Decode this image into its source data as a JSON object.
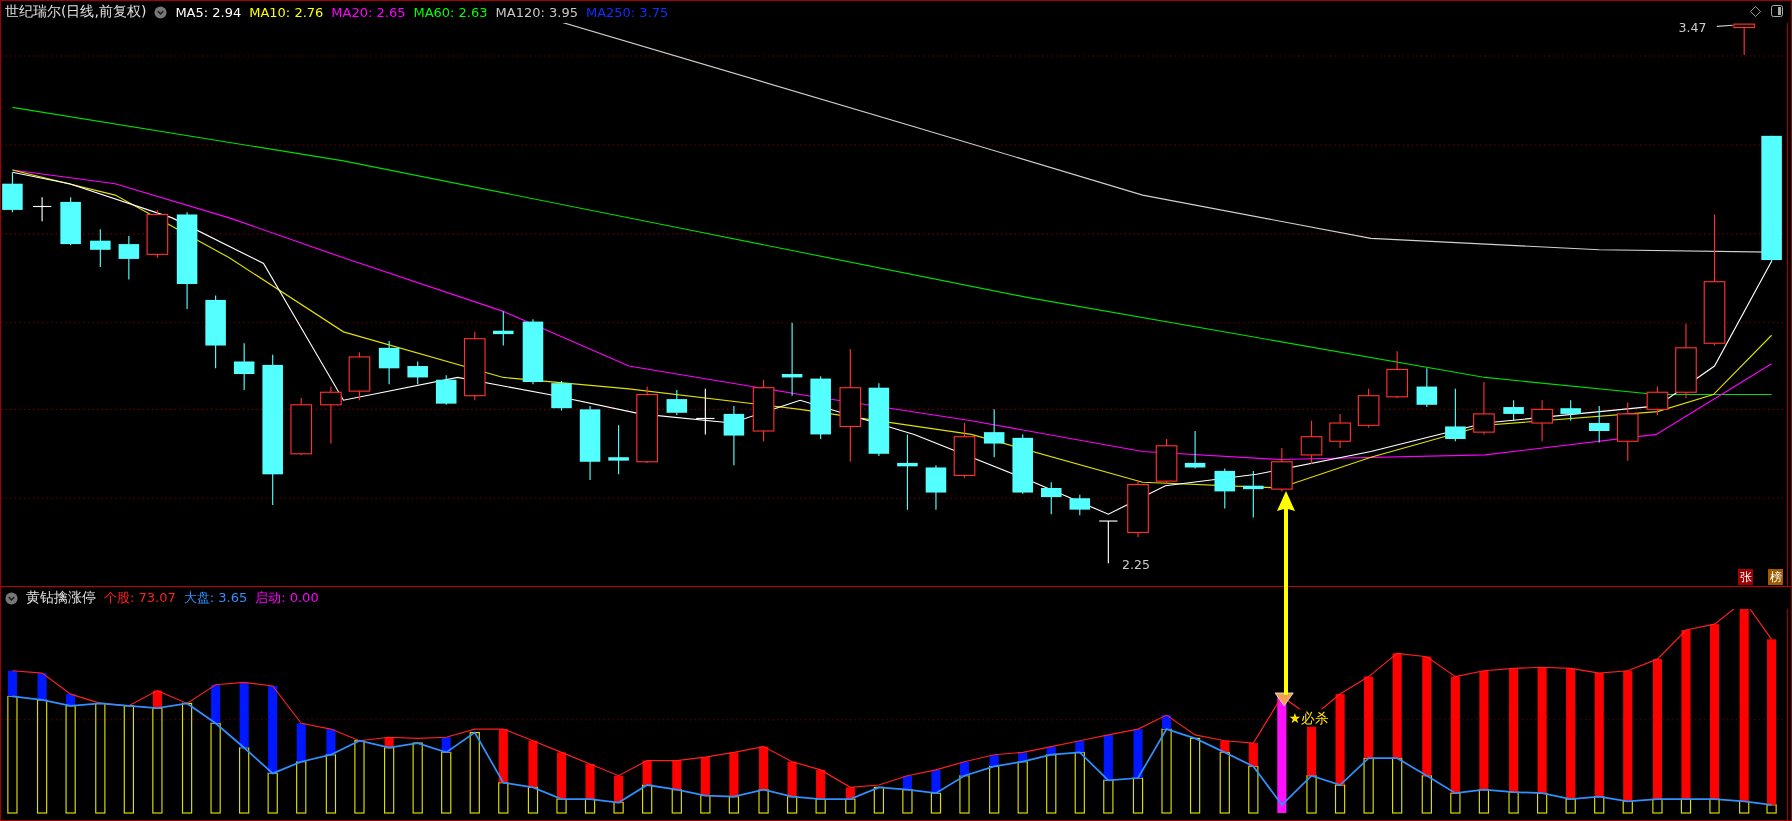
{
  "header": {
    "title": "世纪瑞尔(日线,前复权)",
    "indicators": [
      {
        "label": "MA5: 2.94",
        "color": "#ffffff"
      },
      {
        "label": "MA10: 2.76",
        "color": "#ffff00"
      },
      {
        "label": "MA20: 2.65",
        "color": "#ff00ff"
      },
      {
        "label": "MA60: 2.63",
        "color": "#00ff00"
      },
      {
        "label": "MA120: 3.95",
        "color": "#c8c8c8"
      },
      {
        "label": "MA250: 3.75",
        "color": "#1030ff"
      }
    ]
  },
  "chart": {
    "high_label": "3.47",
    "low_label": "2.25",
    "badges": [
      {
        "text": "张",
        "color": "#a00000"
      },
      {
        "text": "榜",
        "color": "#a05a00"
      }
    ]
  },
  "indicator": {
    "title": "黄钻擒涨停",
    "readings": [
      {
        "label": "个股: 73.07",
        "color": "#ff2020"
      },
      {
        "label": "大盘: 3.65",
        "color": "#3090ff"
      },
      {
        "label": "启动: 0.00",
        "color": "#ff00ff"
      }
    ],
    "signal_label": "★必杀"
  }
}
